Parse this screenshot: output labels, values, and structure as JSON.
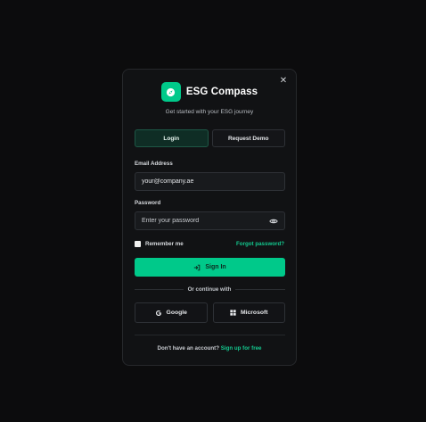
{
  "brand": {
    "title": "ESG Compass",
    "subtitle": "Get started with your ESG journey",
    "accent": "#00c98a"
  },
  "close_icon": "close-icon",
  "tabs": [
    {
      "label": "Login",
      "active": true
    },
    {
      "label": "Request Demo",
      "active": false
    }
  ],
  "email": {
    "label": "Email Address",
    "value": "your@company.ae"
  },
  "password": {
    "label": "Password",
    "placeholder": "Enter your password"
  },
  "remember_label": "Remember me",
  "forgot_label": "Forgot password?",
  "signin_label": "Sign In",
  "divider_label": "Or continue with",
  "social": {
    "google_label": "Google",
    "microsoft_label": "Microsoft"
  },
  "footer": {
    "prompt": "Don't have an account?",
    "link": "Sign up for free"
  }
}
